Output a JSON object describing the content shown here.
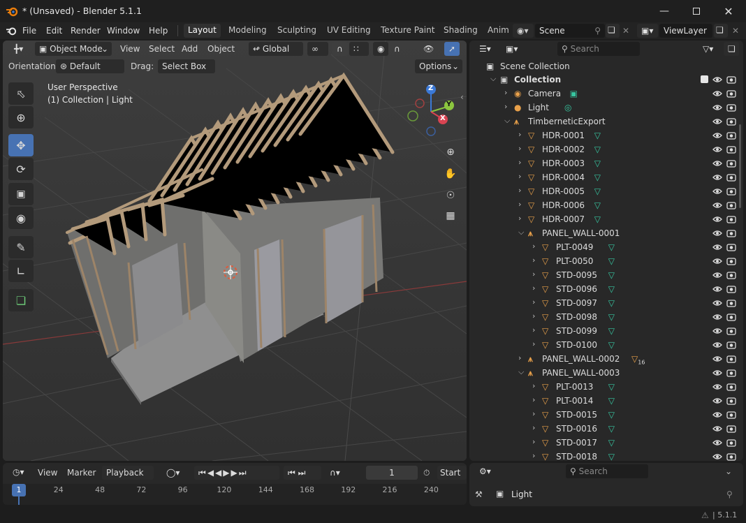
{
  "window": {
    "title": "* (Unsaved) - Blender 5.1.1"
  },
  "menus": [
    "File",
    "Edit",
    "Render",
    "Window",
    "Help"
  ],
  "workspaces": [
    "Layout",
    "Modeling",
    "Sculpting",
    "UV Editing",
    "Texture Paint",
    "Shading",
    "Anim"
  ],
  "scene": {
    "name": "Scene",
    "view_layer": "ViewLayer"
  },
  "viewport": {
    "mode": "Object Mode",
    "menus": [
      "View",
      "Select",
      "Add",
      "Object"
    ],
    "transform_orientation": "Global",
    "orientation_label": "Orientation:",
    "orientation_value": "Default",
    "drag_label": "Drag:",
    "drag_value": "Select Box",
    "options": "Options",
    "perspective": "User Perspective",
    "context": "(1) Collection | Light",
    "axis_x": "X",
    "axis_y": "Y",
    "axis_z": "Z"
  },
  "outliner": {
    "search_placeholder": "Search",
    "root": "Scene Collection",
    "rows": [
      {
        "label": "Collection",
        "indent": 0,
        "expanded": true,
        "icon": "collection-icon",
        "checkbox": true
      },
      {
        "label": "Camera",
        "indent": 1,
        "expanded": false,
        "icon": "camera-icon",
        "data": "camera-data-icon"
      },
      {
        "label": "Light",
        "indent": 1,
        "expanded": false,
        "icon": "light-icon",
        "data": "light-data-icon"
      },
      {
        "label": "TimberneticExport",
        "indent": 1,
        "expanded": true,
        "icon": "empty-icon"
      },
      {
        "label": "HDR-0001",
        "indent": 2,
        "expanded": false,
        "icon": "mesh-icon",
        "data": "mesh-data-icon"
      },
      {
        "label": "HDR-0002",
        "indent": 2,
        "expanded": false,
        "icon": "mesh-icon",
        "data": "mesh-data-icon"
      },
      {
        "label": "HDR-0003",
        "indent": 2,
        "expanded": false,
        "icon": "mesh-icon",
        "data": "mesh-data-icon"
      },
      {
        "label": "HDR-0004",
        "indent": 2,
        "expanded": false,
        "icon": "mesh-icon",
        "data": "mesh-data-icon"
      },
      {
        "label": "HDR-0005",
        "indent": 2,
        "expanded": false,
        "icon": "mesh-icon",
        "data": "mesh-data-icon"
      },
      {
        "label": "HDR-0006",
        "indent": 2,
        "expanded": false,
        "icon": "mesh-icon",
        "data": "mesh-data-icon"
      },
      {
        "label": "HDR-0007",
        "indent": 2,
        "expanded": false,
        "icon": "mesh-icon",
        "data": "mesh-data-icon"
      },
      {
        "label": "PANEL_WALL-0001",
        "indent": 2,
        "expanded": true,
        "icon": "empty-icon"
      },
      {
        "label": "PLT-0049",
        "indent": 3,
        "expanded": false,
        "icon": "mesh-icon",
        "data": "mesh-data-icon"
      },
      {
        "label": "PLT-0050",
        "indent": 3,
        "expanded": false,
        "icon": "mesh-icon",
        "data": "mesh-data-icon"
      },
      {
        "label": "STD-0095",
        "indent": 3,
        "expanded": false,
        "icon": "mesh-icon",
        "data": "mesh-data-icon"
      },
      {
        "label": "STD-0096",
        "indent": 3,
        "expanded": false,
        "icon": "mesh-icon",
        "data": "mesh-data-icon"
      },
      {
        "label": "STD-0097",
        "indent": 3,
        "expanded": false,
        "icon": "mesh-icon",
        "data": "mesh-data-icon"
      },
      {
        "label": "STD-0098",
        "indent": 3,
        "expanded": false,
        "icon": "mesh-icon",
        "data": "mesh-data-icon"
      },
      {
        "label": "STD-0099",
        "indent": 3,
        "expanded": false,
        "icon": "mesh-icon",
        "data": "mesh-data-icon"
      },
      {
        "label": "STD-0100",
        "indent": 3,
        "expanded": false,
        "icon": "mesh-icon",
        "data": "mesh-data-icon"
      },
      {
        "label": "PANEL_WALL-0002",
        "indent": 2,
        "expanded": false,
        "icon": "empty-icon",
        "badge": "16"
      },
      {
        "label": "PANEL_WALL-0003",
        "indent": 2,
        "expanded": true,
        "icon": "empty-icon"
      },
      {
        "label": "PLT-0013",
        "indent": 3,
        "expanded": false,
        "icon": "mesh-icon",
        "data": "mesh-data-icon"
      },
      {
        "label": "PLT-0014",
        "indent": 3,
        "expanded": false,
        "icon": "mesh-icon",
        "data": "mesh-data-icon"
      },
      {
        "label": "STD-0015",
        "indent": 3,
        "expanded": false,
        "icon": "mesh-icon",
        "data": "mesh-data-icon"
      },
      {
        "label": "STD-0016",
        "indent": 3,
        "expanded": false,
        "icon": "mesh-icon",
        "data": "mesh-data-icon"
      },
      {
        "label": "STD-0017",
        "indent": 3,
        "expanded": false,
        "icon": "mesh-icon",
        "data": "mesh-data-icon"
      },
      {
        "label": "STD-0018",
        "indent": 3,
        "expanded": false,
        "icon": "mesh-icon",
        "data": "mesh-data-icon"
      }
    ]
  },
  "timeline": {
    "menus": [
      "View",
      "Marker",
      "Playback"
    ],
    "current_frame": "1",
    "start_label": "Start",
    "ruler": [
      "1",
      "24",
      "48",
      "72",
      "96",
      "120",
      "144",
      "168",
      "192",
      "216",
      "240"
    ]
  },
  "properties": {
    "search_placeholder": "Search",
    "object": "Light"
  },
  "status": {
    "version": "5.1.1"
  },
  "colors": {
    "accent": "#4772b3",
    "mesh": "#e8a04a",
    "data_green": "#37c6a0",
    "bg": "#1d1d1d"
  }
}
